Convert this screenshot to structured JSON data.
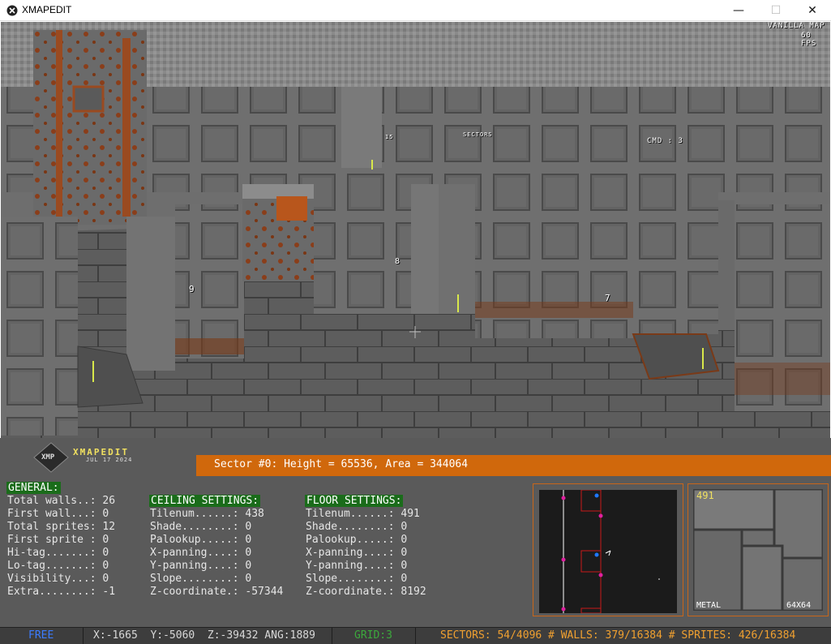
{
  "window": {
    "title": "XMAPEDIT",
    "minimize_glyph": "—",
    "maximize_glyph": "☐",
    "close_glyph": "✕"
  },
  "viewport": {
    "map_type": "VANILLA MAP",
    "fps": "60 FPS",
    "labels": {
      "sectors": "SECTORS",
      "cmd": "CMD : 3",
      "num_8": "8",
      "num_9": "9",
      "num_7": "7",
      "num_15": "15"
    }
  },
  "logo": {
    "badge": "XMP",
    "name": "XMAPEDIT",
    "date": "JUL 17 2024"
  },
  "status": {
    "sector_line": "Sector #0: Height = 65536, Area = 344064"
  },
  "general": {
    "title": "GENERAL:",
    "lines": [
      "Total walls..: 26",
      "First wall...: 0",
      "Total sprites: 12",
      "First sprite : 0",
      "Hi-tag.......: 0",
      "Lo-tag.......: 0",
      "Visibility...: 0",
      "Extra........: -1"
    ]
  },
  "ceiling": {
    "title": "CEILING SETTINGS:",
    "lines": [
      "Tilenum......: 438",
      "Shade........: 0",
      "Palookup.....: 0",
      "X-panning....: 0",
      "Y-panning....: 0",
      "Slope........: 0",
      "Z-coordinate.: -57344"
    ]
  },
  "floor": {
    "title": "FLOOR SETTINGS:",
    "lines": [
      "Tilenum......: 491",
      "Shade........: 0",
      "Palookup.....: 0",
      "X-panning....: 0",
      "Y-panning....: 0",
      "Slope........: 0",
      "Z-coordinate.: 8192"
    ]
  },
  "tile_preview": {
    "number": "491",
    "material": "METAL",
    "size": "64X64"
  },
  "bottom": {
    "mode": "FREE",
    "coords": "X:-1665  Y:-5060  Z:-39432 ANG:1889",
    "grid": "GRID:3",
    "counts": "SECTORS: 54/4096 # WALLS: 379/16384 # SPRITES: 426/16384"
  },
  "colors": {
    "accent_orange": "#d0680c",
    "section_green": "#1a6c1a",
    "panel_gray": "#5a5a5a",
    "mode_blue": "#3c7cff",
    "grid_green": "#3ca83c",
    "counts_orange": "#f0a030",
    "tile_number_yellow": "#f0e060"
  }
}
